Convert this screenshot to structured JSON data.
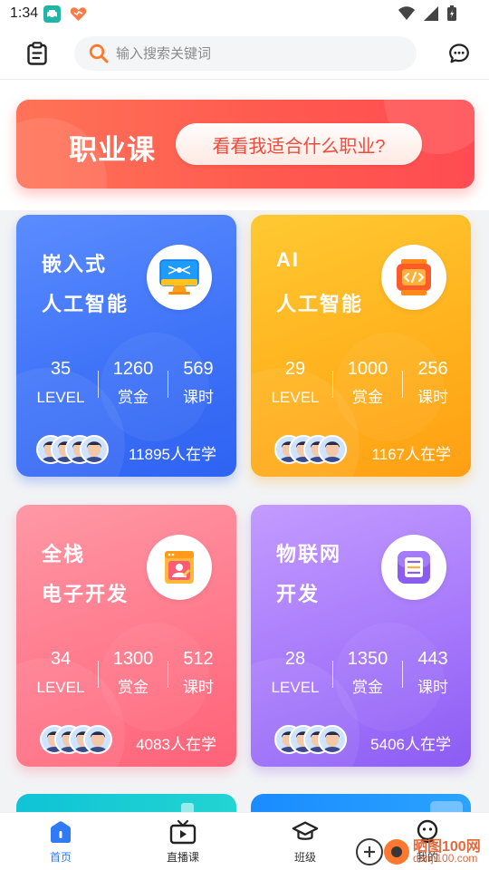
{
  "status_bar": {
    "time": "1:34"
  },
  "search": {
    "placeholder": "输入搜索关键词",
    "value": ""
  },
  "banner": {
    "title": "职业课",
    "button_label": "看看我适合什么职业?"
  },
  "cards": [
    {
      "title_line1": "嵌入式",
      "title_line2": "人工智能",
      "icon": "monitor-icon",
      "stats": [
        {
          "value": "35",
          "label": "LEVEL"
        },
        {
          "value": "1260",
          "label": "赏金"
        },
        {
          "value": "569",
          "label": "课时"
        }
      ],
      "learners": "11895人在学"
    },
    {
      "title_line1": "AI",
      "title_line2": "人工智能",
      "icon": "code-chip-icon",
      "stats": [
        {
          "value": "29",
          "label": "LEVEL"
        },
        {
          "value": "1000",
          "label": "赏金"
        },
        {
          "value": "256",
          "label": "课时"
        }
      ],
      "learners": "1167人在学"
    },
    {
      "title_line1": "全栈",
      "title_line2": "电子开发",
      "icon": "profile-window-icon",
      "stats": [
        {
          "value": "34",
          "label": "LEVEL"
        },
        {
          "value": "1300",
          "label": "赏金"
        },
        {
          "value": "512",
          "label": "课时"
        }
      ],
      "learners": "4083人在学"
    },
    {
      "title_line1": "物联网",
      "title_line2": "开发",
      "icon": "iot-device-icon",
      "stats": [
        {
          "value": "28",
          "label": "LEVEL"
        },
        {
          "value": "1350",
          "label": "赏金"
        },
        {
          "value": "443",
          "label": "课时"
        }
      ],
      "learners": "5406人在学"
    }
  ],
  "tabs": [
    {
      "label": "首页",
      "icon": "home-icon",
      "active": true
    },
    {
      "label": "直播课",
      "icon": "tv-icon",
      "active": false
    },
    {
      "label": "班级",
      "icon": "graduation-cap-icon",
      "active": false
    },
    {
      "label": "我的",
      "icon": "profile-icon",
      "active": false
    }
  ],
  "watermark": {
    "text": "晒图100网",
    "url": "danji100.com"
  },
  "colors": {
    "accent": "#2f7bf6",
    "banner": "#ff5a4f",
    "card_blue": "#3f73f8",
    "card_orange": "#ffb21d",
    "card_pink": "#ff7a8c",
    "card_purple": "#a779fb"
  }
}
